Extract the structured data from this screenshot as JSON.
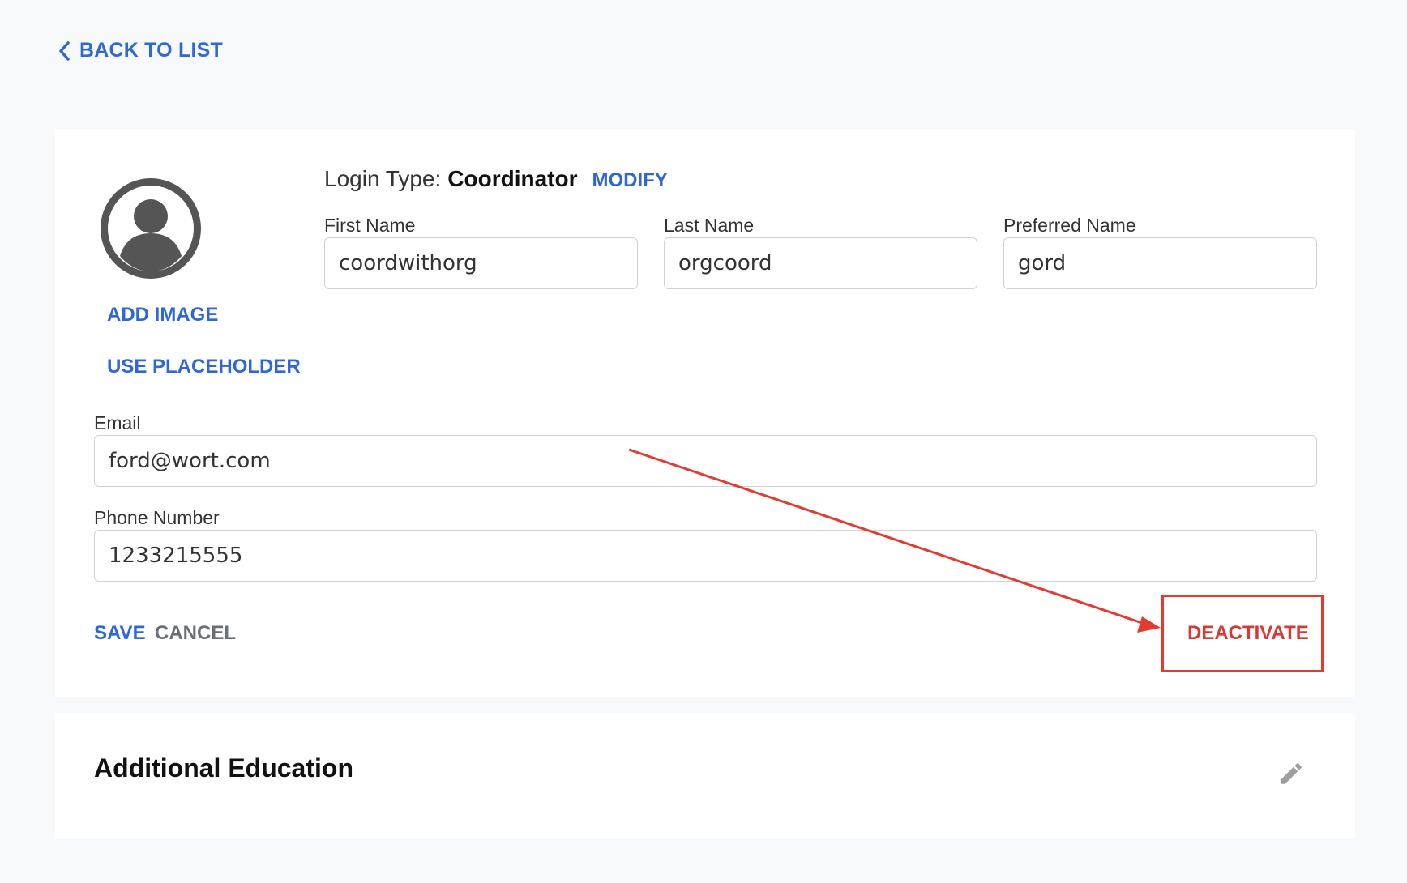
{
  "nav": {
    "back_label": "BACK TO LIST"
  },
  "profile": {
    "add_image_label": "ADD IMAGE",
    "use_placeholder_label": "USE PLACEHOLDER",
    "login_type_label": "Login Type:",
    "login_type_value": "Coordinator",
    "modify_label": "MODIFY"
  },
  "form": {
    "first_name": {
      "label": "First Name",
      "value": "coordwithorg"
    },
    "last_name": {
      "label": "Last Name",
      "value": "orgcoord"
    },
    "preferred_name": {
      "label": "Preferred Name",
      "value": "gord"
    },
    "email": {
      "label": "Email",
      "value": "ford@wort.com"
    },
    "phone": {
      "label": "Phone Number",
      "value": "1233215555"
    }
  },
  "actions": {
    "save_label": "SAVE",
    "cancel_label": "CANCEL",
    "deactivate_label": "DEACTIVATE"
  },
  "education": {
    "title": "Additional Education"
  },
  "icons": {
    "back": "chevron-left-icon",
    "avatar": "user-circle-icon",
    "edit": "pencil-icon"
  },
  "colors": {
    "accent": "#2f67d8",
    "danger": "#d63a32",
    "annotation": "#e23c31",
    "background": "#f8f9fb",
    "card": "#ffffff"
  }
}
